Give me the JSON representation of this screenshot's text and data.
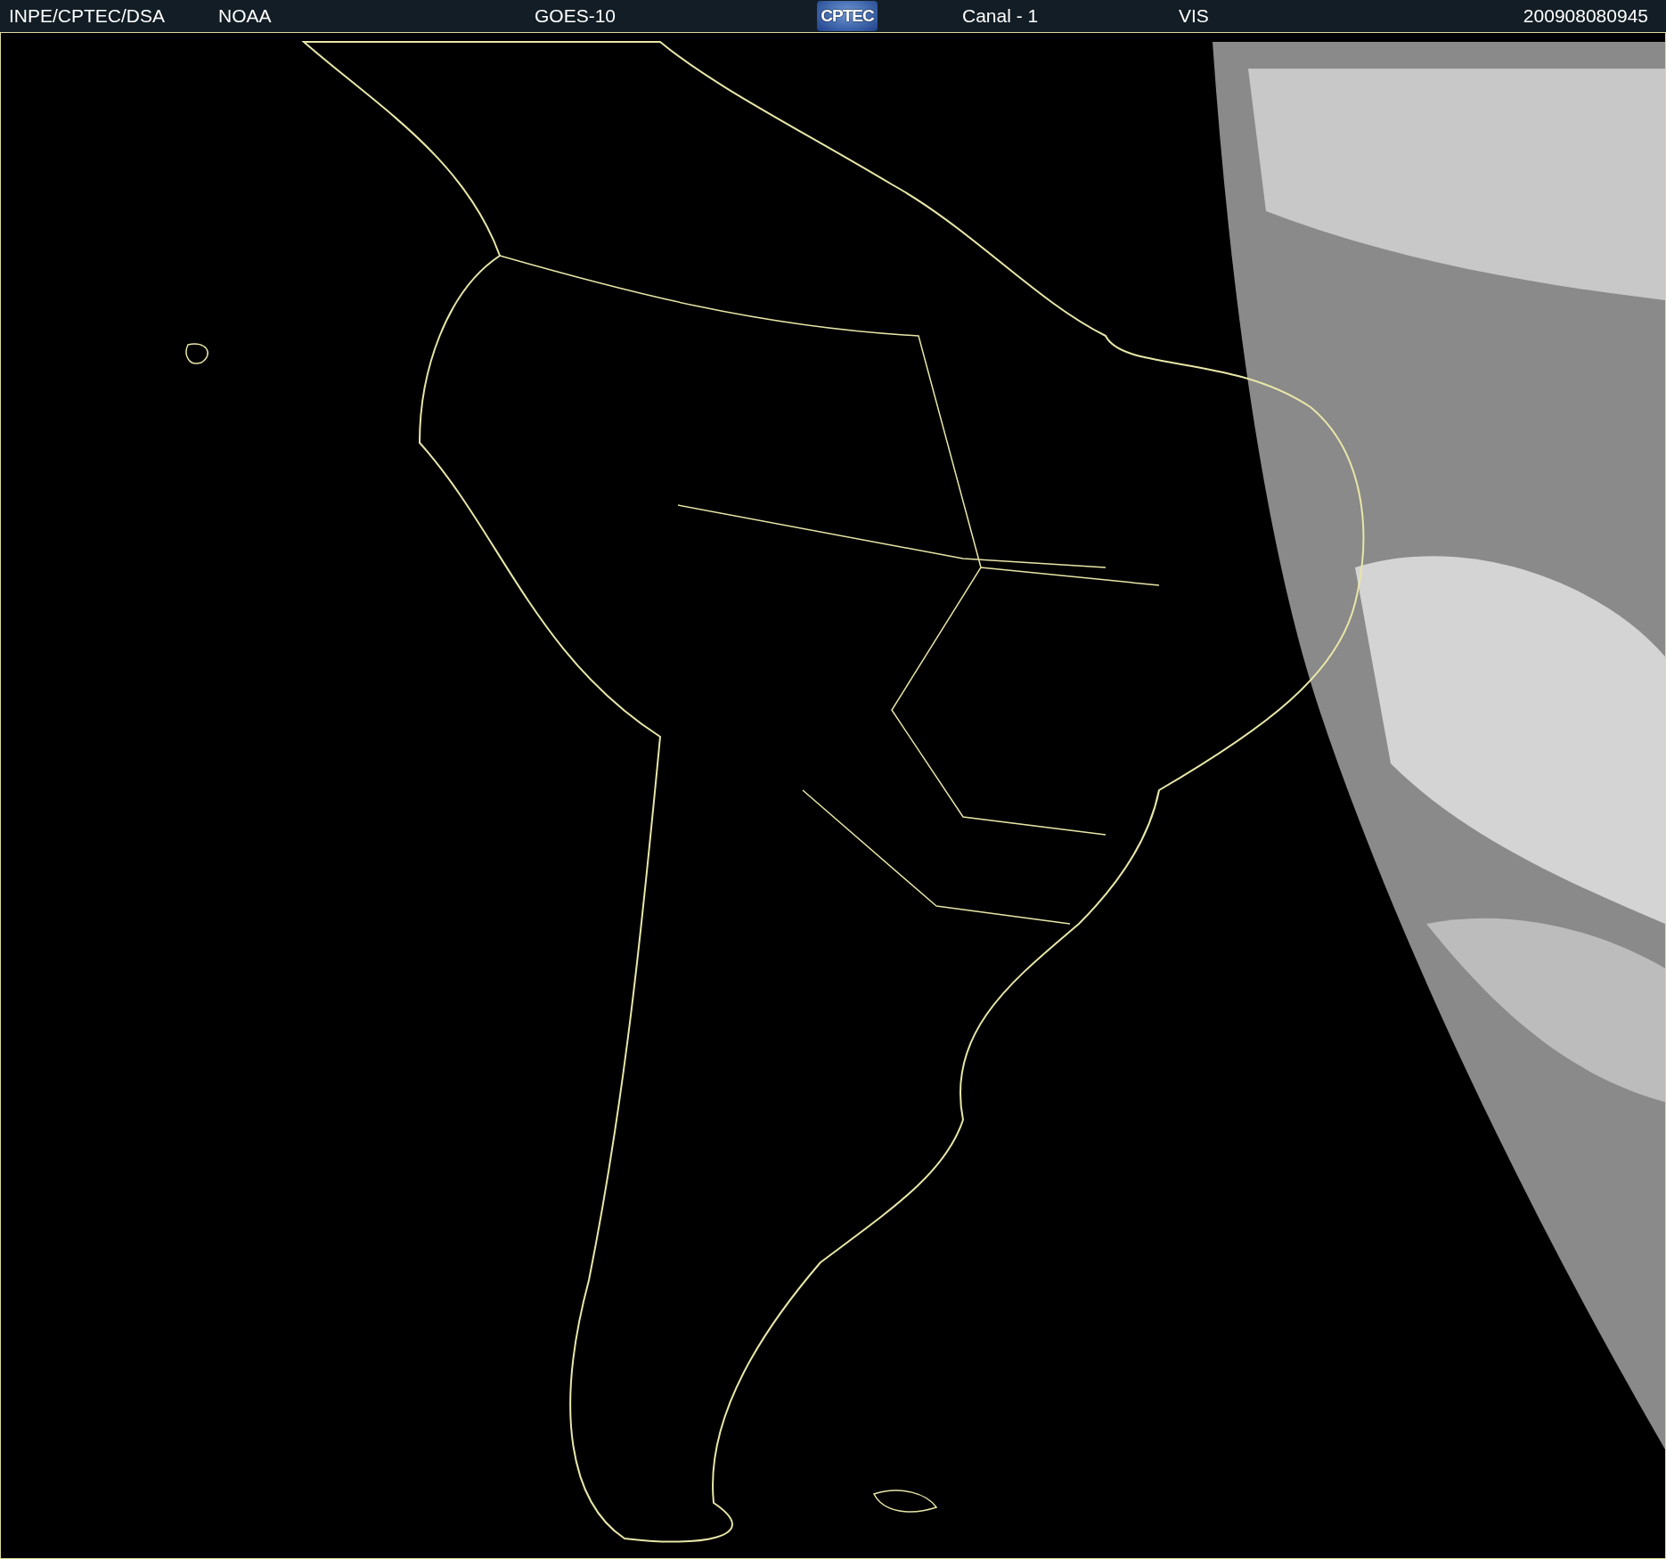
{
  "header": {
    "items": [
      {
        "kind": "text",
        "text": "INPE/CPTEC/DSA"
      },
      {
        "kind": "text",
        "text": "NOAA"
      },
      {
        "kind": "text",
        "text": "GOES-10"
      },
      {
        "kind": "logo",
        "text": "CPTEC"
      },
      {
        "kind": "text",
        "text": "Canal - 1"
      },
      {
        "kind": "text",
        "text": "VIS"
      },
      {
        "kind": "text",
        "text": "200908080945"
      }
    ]
  }
}
